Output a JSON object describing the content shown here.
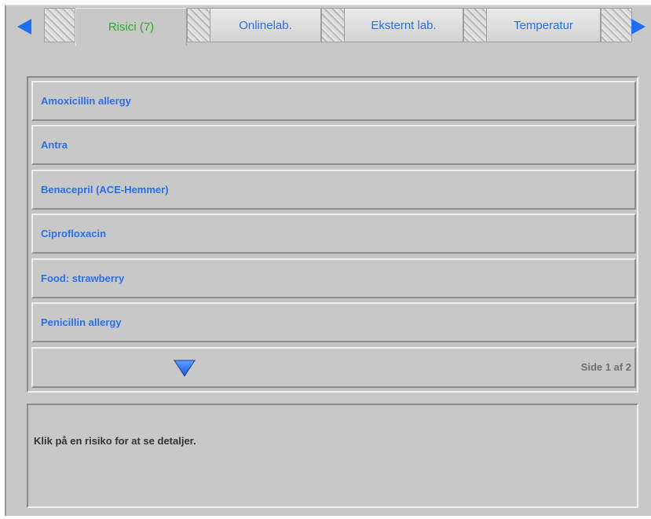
{
  "tabs": [
    {
      "label": "Risici (7)",
      "active": true
    },
    {
      "label": "Onlinelab.",
      "active": false
    },
    {
      "label": "Eksternt lab.",
      "active": false
    },
    {
      "label": "Temperatur",
      "active": false
    }
  ],
  "risks": [
    {
      "label": "Amoxicillin allergy"
    },
    {
      "label": "Antra"
    },
    {
      "label": "Benacepril (ACE-Hemmer)"
    },
    {
      "label": "Ciprofloxacin"
    },
    {
      "label": "Food: strawberry"
    },
    {
      "label": "Penicillin allergy"
    }
  ],
  "pager": {
    "page_text": "Side 1 af 2"
  },
  "detail": {
    "hint": "Klik på en risiko for at se detaljer."
  },
  "colors": {
    "accent_blue": "#2a6fe8",
    "active_green": "#2eaa2e",
    "arrow_blue": "#1e6ef0",
    "panel_grey": "#c8c8c8"
  },
  "icons": {
    "nav_prev": "triangle-left",
    "nav_next": "triangle-right",
    "scroll_down": "triangle-down"
  }
}
